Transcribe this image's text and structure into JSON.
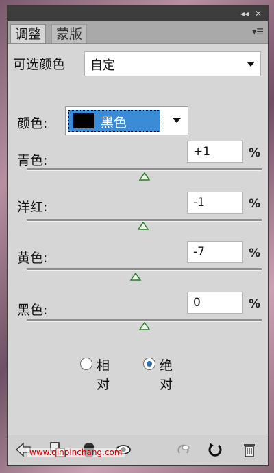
{
  "panel": {
    "tabs": [
      {
        "label": "调整",
        "active": true
      },
      {
        "label": "蒙版",
        "active": false
      }
    ]
  },
  "preset": {
    "label": "可选颜色",
    "value": "自定"
  },
  "colors": {
    "label": "颜色:",
    "value": "黑色",
    "swatch": "#000000"
  },
  "sliders": [
    {
      "label": "青色:",
      "value": "+1",
      "unit": "%",
      "fraction": 0.5
    },
    {
      "label": "洋红:",
      "value": "-1",
      "unit": "%",
      "fraction": 0.495
    },
    {
      "label": "黄色:",
      "value": "-7",
      "unit": "%",
      "fraction": 0.465
    },
    {
      "label": "黑色:",
      "value": "0",
      "unit": "%",
      "fraction": 0.5
    }
  ],
  "method": {
    "options": [
      {
        "label": "相对",
        "selected": false
      },
      {
        "label": "绝对",
        "selected": true
      }
    ]
  },
  "watermark": "www.qinpinchang.com",
  "accent": "#3b8bd6"
}
